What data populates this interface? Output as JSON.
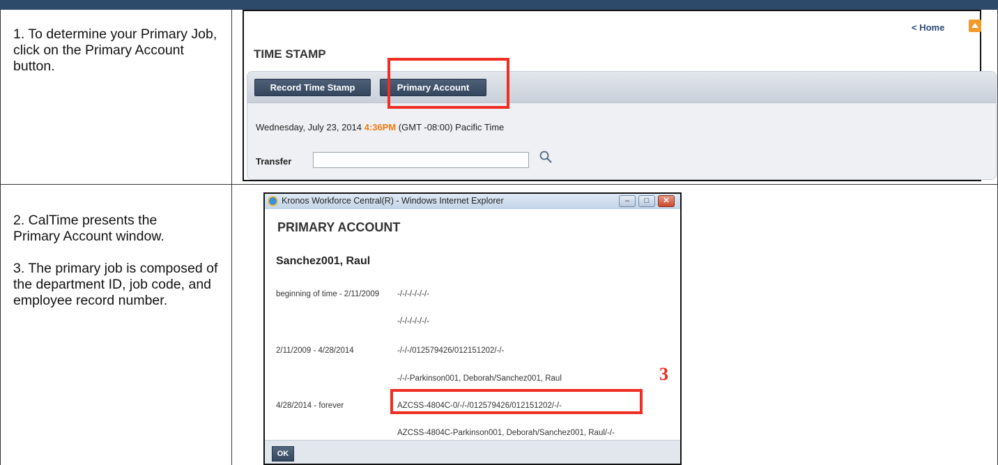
{
  "steps": {
    "step1_text": "1. To determine your Primary Job, click on the Primary Account button.",
    "step2_text": "2. CalTime presents the Primary Account window.",
    "step3_text": "3. The primary job is composed of the department ID, job code, and employee record number."
  },
  "timestamp_panel": {
    "home_link": "< Home",
    "title": "TIME STAMP",
    "record_button": "Record Time Stamp",
    "primary_account_button": "Primary Account",
    "date_text": "Wednesday, July 23, 2014",
    "time_text": "4:36PM",
    "tz_text": "(GMT -08:00) Pacific Time",
    "transfer_label": "Transfer",
    "transfer_value": "",
    "time_color": "#f07a12"
  },
  "primary_account_window": {
    "window_title": "Kronos Workforce Central(R) - Windows Internet Explorer",
    "heading": "PRIMARY ACCOUNT",
    "employee_name": "Sanchez001, Raul",
    "rows": [
      {
        "range": "beginning of time - 2/11/2009",
        "line1": "-/-/-/-/-/-/-",
        "line2": "-/-/-/-/-/-/-"
      },
      {
        "range": "2/11/2009 - 4/28/2014",
        "line1": "-/-/-/012579426/012151202/-/-",
        "line2": "-/-/-Parkinson001, Deborah/Sanchez001, Raul"
      },
      {
        "range": "4/28/2014 - forever",
        "line1": "AZCSS-4804C-0/-/-/012579426/012151202/-/-",
        "line2": "AZCSS-4804C-Parkinson001, Deborah/Sanchez001, Raul/-/-"
      }
    ],
    "ok_button": "OK"
  },
  "callout_number": "3",
  "accent_colors": {
    "highlight_red": "#ef2d22",
    "header_navy": "#2e4a6b"
  }
}
